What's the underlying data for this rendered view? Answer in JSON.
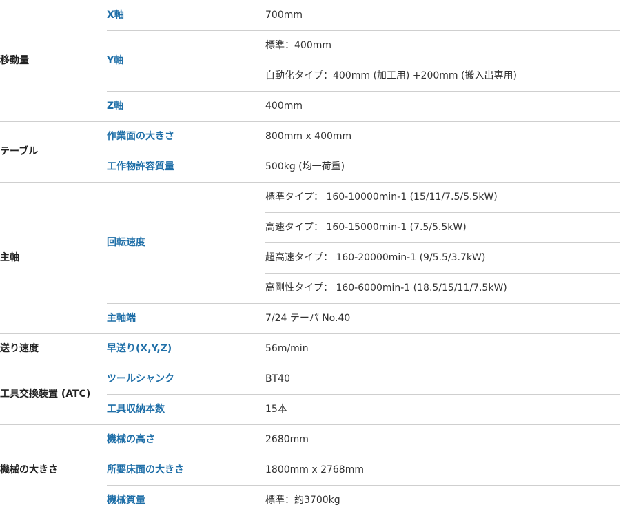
{
  "rows": [
    {
      "category": "移動量",
      "items": [
        {
          "label": "X軸",
          "values": [
            "700mm"
          ]
        },
        {
          "label": "Y軸",
          "values": [
            "標準：400mm",
            "自動化タイプ：400mm (加工用) +200mm (搬入出専用)"
          ]
        },
        {
          "label": "Z軸",
          "values": [
            "400mm"
          ]
        }
      ]
    },
    {
      "category": "テーブル",
      "items": [
        {
          "label": "作業面の大きさ",
          "values": [
            "800mm x 400mm"
          ]
        },
        {
          "label": "工作物許容質量",
          "values": [
            "500kg (均一荷重)"
          ]
        }
      ]
    },
    {
      "category": "主軸",
      "items": [
        {
          "label": "回転速度",
          "values": [
            "標準タイプ： 160-10000min-1 (15/11/7.5/5.5kW)",
            "高速タイプ： 160-15000min-1 (7.5/5.5kW)",
            "超高速タイプ： 160-20000min-1 (9/5.5/3.7kW)",
            "高剛性タイプ： 160-6000min-1 (18.5/15/11/7.5kW)"
          ]
        },
        {
          "label": "主軸端",
          "values": [
            "7/24 テーパ No.40"
          ]
        }
      ]
    },
    {
      "category": "送り速度",
      "items": [
        {
          "label": "早送り(X,Y,Z)",
          "values": [
            "56m/min"
          ]
        }
      ]
    },
    {
      "category": "工具交換装置 (ATC)",
      "items": [
        {
          "label": "ツールシャンク",
          "values": [
            "BT40"
          ]
        },
        {
          "label": "工具収納本数",
          "values": [
            "15本"
          ]
        }
      ]
    },
    {
      "category": "機械の大きさ",
      "items": [
        {
          "label": "機械の高さ",
          "values": [
            "2680mm"
          ]
        },
        {
          "label": "所要床面の大きさ",
          "values": [
            "1800mm x 2768mm"
          ]
        },
        {
          "label": "機械質量",
          "values": [
            "標準：約3700kg"
          ]
        }
      ]
    }
  ],
  "colors": {
    "label_blue": "#1f6fa8",
    "border": "#cfcfcf",
    "text": "#333333"
  }
}
